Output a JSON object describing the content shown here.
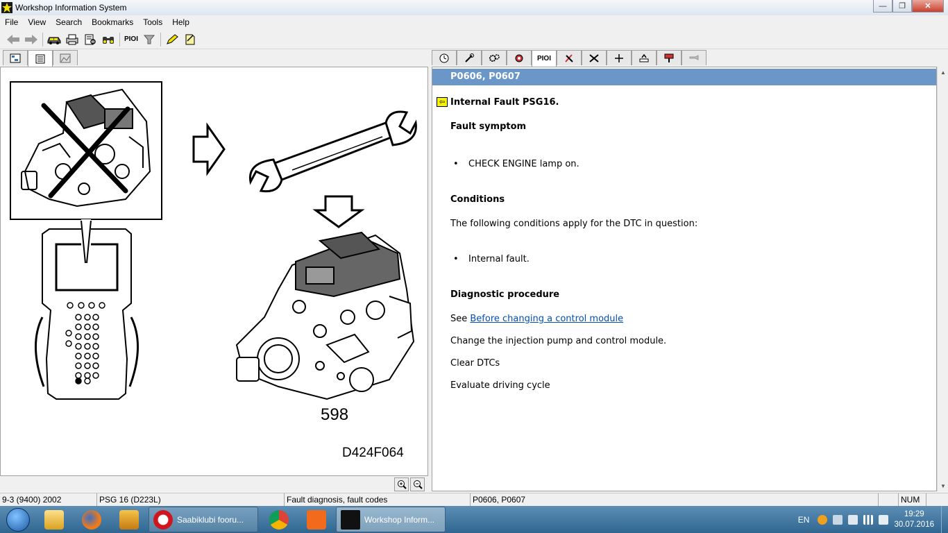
{
  "window": {
    "title": "Workshop Information System"
  },
  "menu": [
    "File",
    "View",
    "Search",
    "Bookmarks",
    "Tools",
    "Help"
  ],
  "toolbar": {
    "pioi_label": "PIOI"
  },
  "right_tabs": {
    "pioi_label": "PIOI"
  },
  "figure": {
    "number": "598",
    "code": "D424F064"
  },
  "document": {
    "header": "P0606, P0607",
    "title": "Internal Fault PSG16.",
    "fault_symptom_heading": "Fault symptom",
    "fault_symptom_item": "CHECK ENGINE lamp on.",
    "conditions_heading": "Conditions",
    "conditions_text": "The following conditions apply for the DTC in question:",
    "conditions_item": "Internal fault.",
    "diagnostic_heading": "Diagnostic procedure",
    "see_prefix": "See",
    "see_link": "Before changing a control module",
    "step_change": "Change the injection pump and control module.",
    "step_clear": "Clear DTCs",
    "step_evaluate": "Evaluate driving cycle"
  },
  "status": {
    "model": "9-3 (9400) 2002",
    "engine": "PSG 16 (D223L)",
    "section": "Fault diagnosis, fault codes",
    "codes": "P0606, P0607",
    "num": "NUM"
  },
  "taskbar": {
    "tasks": [
      "Saabiklubi fooru...",
      "Workshop Inform..."
    ],
    "lang": "EN",
    "time": "19:29",
    "date": "30.07.2016"
  }
}
